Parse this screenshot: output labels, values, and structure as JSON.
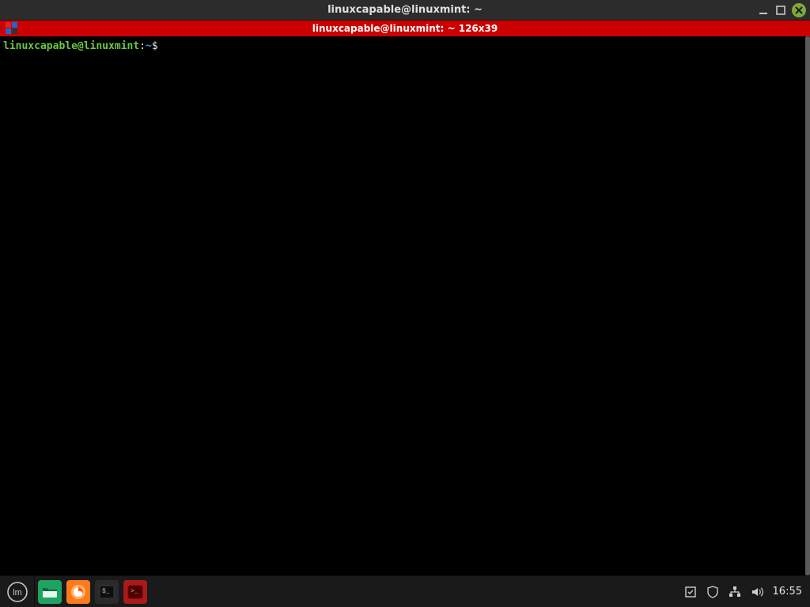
{
  "window": {
    "title": "linuxcapable@linuxmint: ~"
  },
  "tabbar": {
    "label": "linuxcapable@linuxmint: ~ 126x39"
  },
  "prompt": {
    "user_host": "linuxcapable@linuxmint",
    "separator": ":",
    "path": "~",
    "symbol": "$"
  },
  "panel": {
    "clock": "16:55"
  }
}
